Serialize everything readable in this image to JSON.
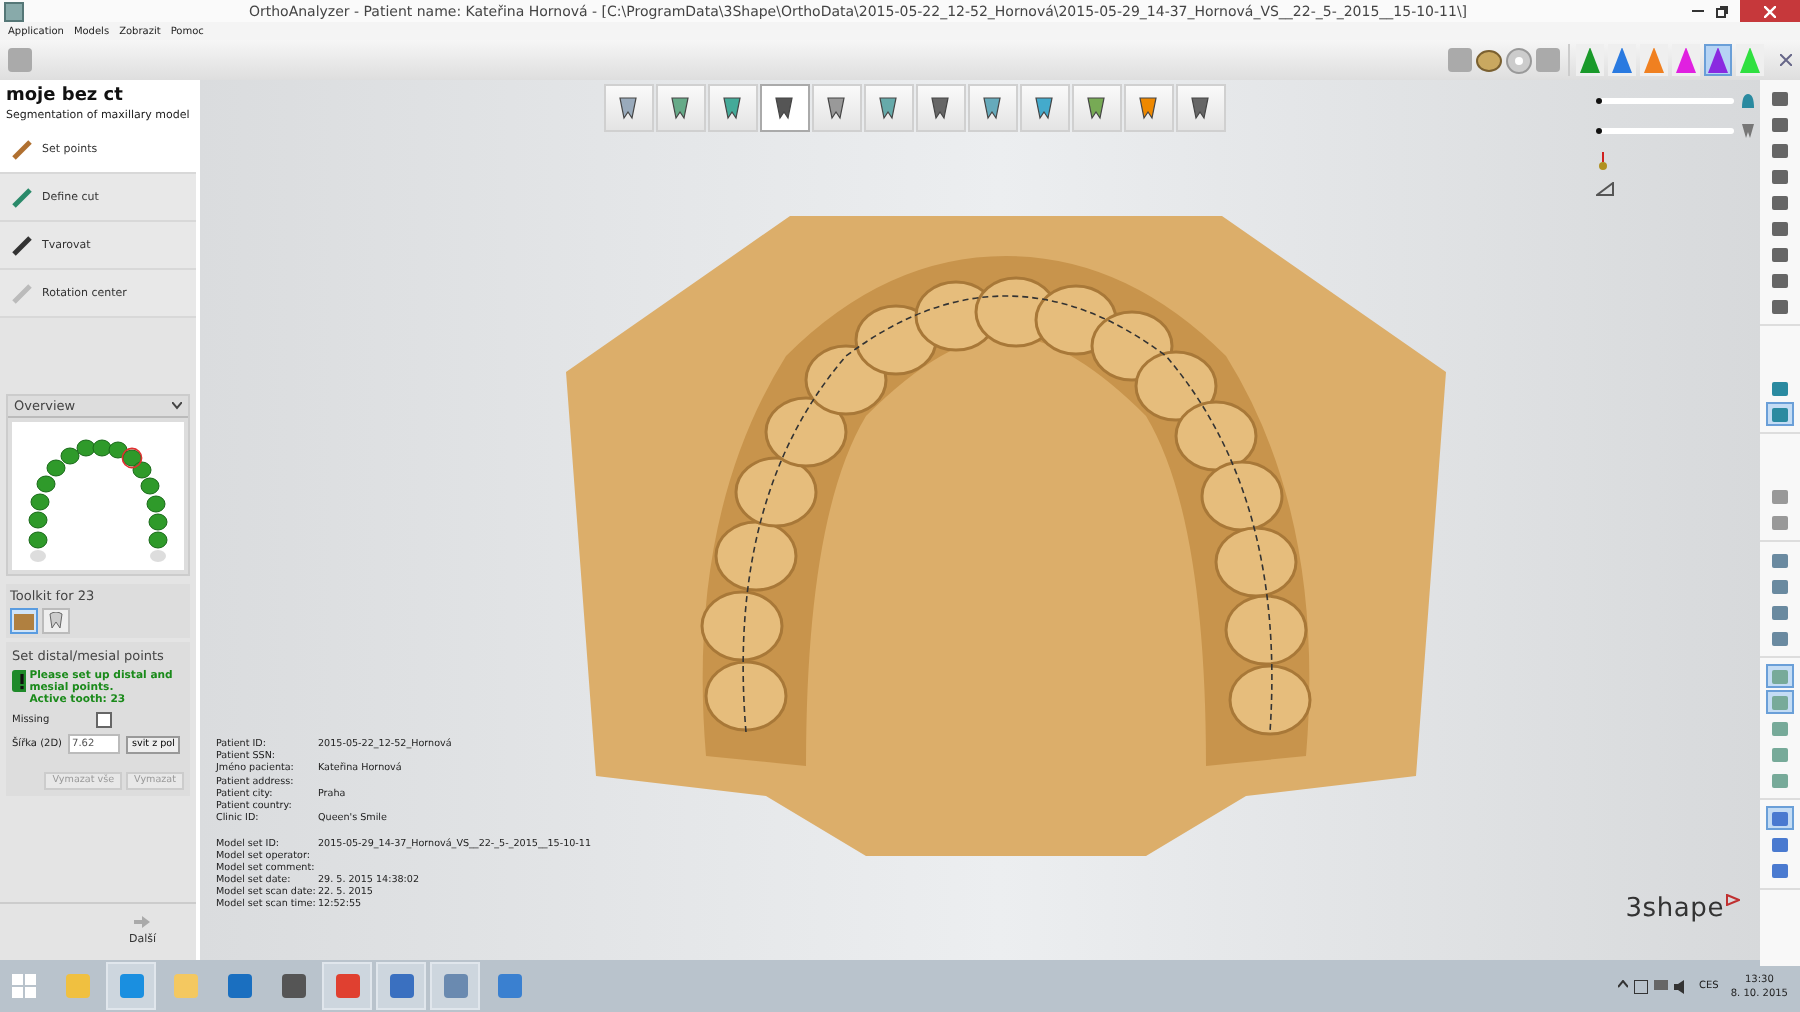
{
  "window": {
    "title": "OrthoAnalyzer - Patient name: Kateřina Hornová - [C:\\ProgramData\\3Shape\\OrthoData\\2015-05-22_12-52_Hornová\\2015-05-29_14-37_Hornová_VS__22-_5-_2015__15-10-11\\]"
  },
  "menu": [
    "Application",
    "Models",
    "Zobrazit",
    "Pomoc"
  ],
  "view_cones": [
    {
      "color": "#1a9a2a",
      "selected": false
    },
    {
      "color": "#2a7ae0",
      "selected": false
    },
    {
      "color": "#f08020",
      "selected": false
    },
    {
      "color": "#e020e0",
      "selected": false
    },
    {
      "color": "#8a2ae0",
      "selected": true
    },
    {
      "color": "#30e040",
      "selected": false
    }
  ],
  "tools": [
    {
      "selected": false
    },
    {
      "selected": false
    },
    {
      "selected": false
    },
    {
      "selected": true
    },
    {
      "selected": false
    },
    {
      "selected": false
    },
    {
      "selected": false
    },
    {
      "selected": false
    },
    {
      "selected": false
    },
    {
      "selected": false
    },
    {
      "selected": false
    },
    {
      "selected": false
    }
  ],
  "left_panel": {
    "title": "moje bez ct",
    "subtitle": "Segmentation of maxillary model",
    "steps": [
      {
        "label": "Set points",
        "selected": true
      },
      {
        "label": "Define cut",
        "selected": false
      },
      {
        "label": "Tvarovat",
        "selected": false
      },
      {
        "label": "Rotation center",
        "selected": false
      }
    ],
    "overview": {
      "title": "Overview"
    },
    "toolkit": {
      "title": "Toolkit for 23",
      "buttons": [
        {
          "selected": true
        },
        {
          "selected": false
        }
      ]
    },
    "points": {
      "title": "Set distal/mesial points",
      "message": [
        "Please set up distal and mesial points.",
        "Active tooth: 23"
      ],
      "missing": {
        "label": "Missing",
        "checked": false
      },
      "width": {
        "label": "Šířka (2D)",
        "value": "7.62",
        "button": "svit z pol"
      },
      "buttons": [
        "Vymazat vše",
        "Vymazat"
      ]
    },
    "next": "Další"
  },
  "info": {
    "patient": [
      {
        "label": "Patient ID:",
        "value": "2015-05-22_12-52_Hornová"
      },
      {
        "label": "Patient SSN:"
      },
      {
        "label": "Jméno pacienta:",
        "value": "Kateřina Hornová"
      },
      {
        "label": "Patient address:"
      },
      {
        "label": "Patient city:",
        "value": "Praha"
      },
      {
        "label": "Patient country:"
      },
      {
        "label": "Clinic ID:",
        "value": "Queen's Smile"
      }
    ],
    "model": [
      {
        "label": "Model set ID:",
        "value": "2015-05-29_14-37_Hornová_VS__22-_5-_2015__15-10-11"
      },
      {
        "label": "Model set operator:"
      },
      {
        "label": "Model set comment:"
      },
      {
        "label": "Model set date:",
        "value": "29. 5. 2015 14:38:02"
      },
      {
        "label": "Model set scan date:",
        "value": "22. 5. 2015"
      },
      {
        "label": "Model set scan time:",
        "value": "12:52:55"
      }
    ]
  },
  "sliders": [
    {
      "level": 0
    },
    {
      "level": 0
    }
  ],
  "logo": "3shape",
  "right_tools": [
    [
      {
        "selected": false
      },
      {
        "selected": false
      },
      {
        "selected": false
      },
      {
        "selected": false
      },
      {
        "selected": false
      },
      {
        "selected": false
      },
      {
        "selected": false
      },
      {
        "selected": false
      },
      {
        "selected": false
      }
    ],
    [
      {
        "selected": false
      },
      {
        "selected": true
      }
    ],
    [
      {
        "selected": false
      },
      {
        "selected": false
      }
    ],
    [
      {
        "selected": false
      },
      {
        "selected": false
      },
      {
        "selected": false
      },
      {
        "selected": false
      }
    ],
    [
      {
        "selected": true
      },
      {
        "selected": true
      },
      {
        "selected": false
      },
      {
        "selected": false
      },
      {
        "selected": false
      }
    ],
    [
      {
        "selected": true
      },
      {
        "selected": false
      },
      {
        "selected": false
      }
    ]
  ],
  "taskbar": {
    "apps": [
      {
        "selected": false
      },
      {
        "selected": true
      },
      {
        "selected": false
      },
      {
        "selected": false
      },
      {
        "selected": false
      },
      {
        "selected": true
      },
      {
        "selected": true
      },
      {
        "selected": true
      },
      {
        "selected": false
      }
    ],
    "language": "CES",
    "time": "13:30",
    "date": "8. 10. 2015"
  }
}
